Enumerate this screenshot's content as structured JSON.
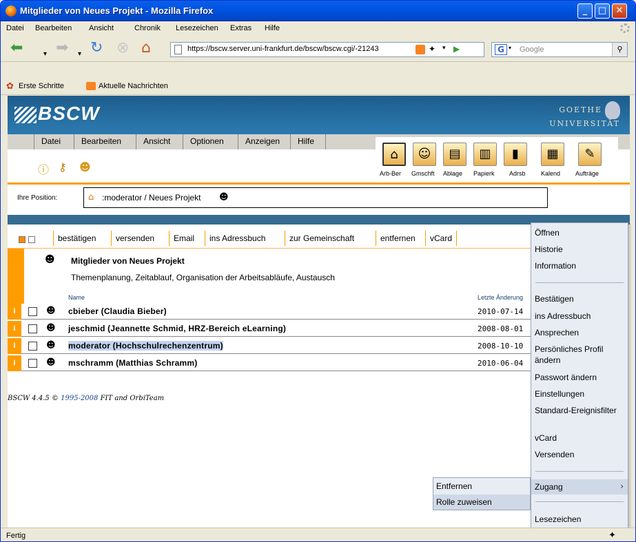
{
  "window": {
    "title": "Mitglieder von Neues Projekt - Mozilla Firefox"
  },
  "browser_menu": [
    "Datei",
    "Bearbeiten",
    "Ansicht",
    "Chronik",
    "Lesezeichen",
    "Extras",
    "Hilfe"
  ],
  "address": {
    "url": "https://bscw.server.uni-frankfurt.de/bscw/bscw.cgi/-21243"
  },
  "search": {
    "placeholder": "Google",
    "engine_icon": "G"
  },
  "bookmarks": [
    "Erste Schritte",
    "Aktuelle Nachrichten"
  ],
  "header": {
    "logo": "BSCW",
    "uni_line1": "GOETHE",
    "uni_line2": "UNIVERSITÄT"
  },
  "bscw_menu": [
    "Datei",
    "Bearbeiten",
    "Ansicht",
    "Optionen",
    "Anzeigen",
    "Hilfe"
  ],
  "big_icons": [
    {
      "label": "Arb-Ber",
      "icon": "home-icon",
      "glyph": "⌂"
    },
    {
      "label": "Gmschft",
      "icon": "community-icon",
      "glyph": "☺"
    },
    {
      "label": "Ablage",
      "icon": "clipboard-icon",
      "glyph": "▤"
    },
    {
      "label": "Papierk",
      "icon": "trash-icon",
      "glyph": "▥"
    },
    {
      "label": "Adrsb",
      "icon": "addressbook-icon",
      "glyph": "▮"
    },
    {
      "label": "Kalend",
      "icon": "calendar-icon",
      "glyph": "▦"
    },
    {
      "label": "Aufträge",
      "icon": "tasks-icon",
      "glyph": "✎"
    }
  ],
  "position": {
    "label": "Ihre Position:",
    "path": ":moderator / Neues Projekt"
  },
  "actions": [
    "bestätigen",
    "versenden",
    "Email",
    "ins Adressbuch",
    "zur Gemeinschaft",
    "entfernen",
    "vCard"
  ],
  "folder": {
    "title": "Mitglieder von Neues Projekt",
    "description": "Themenplanung, Zeitablauf, Organisation der Arbeitsabläufe, Austausch"
  },
  "columns": {
    "name": "Name",
    "date": "Letzte Änderung"
  },
  "members": [
    {
      "name": "cbieber (Claudia Bieber)",
      "date": "2010-07-14"
    },
    {
      "name": "jeschmid (Jeannette Schmid, HRZ-Bereich eLearning)",
      "date": "2008-08-01"
    },
    {
      "name": "moderator (Hochschulrechenzentrum)",
      "date": "2008-10-10"
    },
    {
      "name": "mschramm (Matthias Schramm)",
      "date": "2010-06-04"
    }
  ],
  "credit": {
    "prefix": "BSCW 4.4.5 © ",
    "years": "1995-2008",
    "fit": " FIT",
    "and": " and ",
    "orbi": "OrbiTeam"
  },
  "context_menu": {
    "items_top": [
      "Öffnen",
      "Historie",
      "Information"
    ],
    "items_mid": [
      "Bestätigen",
      "ins Adressbuch",
      "Ansprechen",
      "Persönliches Profil ändern",
      "Passwort ändern",
      "Einstellungen",
      "Standard-Ereignisfilter",
      "vCard",
      "Versenden"
    ],
    "zugang": "Zugang",
    "lesezeichen": "Lesezeichen"
  },
  "submenu": [
    "Entfernen",
    "Rolle zuweisen"
  ],
  "status": {
    "text": "Fertig"
  },
  "colors": {
    "accent": "#ff9c00",
    "header": "#2d7bb0",
    "titlebar": "#0054e3"
  }
}
